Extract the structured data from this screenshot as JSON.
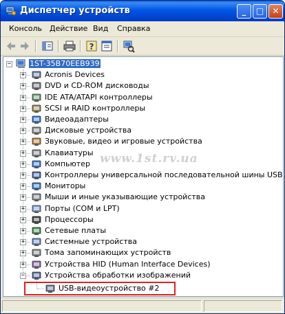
{
  "window": {
    "title": "Диспетчер устройств",
    "controls": {
      "minimize": "_",
      "maximize": "□",
      "close": "✕"
    }
  },
  "menu": {
    "items": [
      "Консоль",
      "Действие",
      "Вид",
      "Справка"
    ]
  },
  "toolbar": {
    "buttons": [
      "back-arrow-icon",
      "forward-arrow-icon",
      "console-tree-icon",
      "print-icon",
      "help-icon",
      "properties-icon",
      "scan-hardware-icon"
    ]
  },
  "tree": {
    "root": "1ST-35B70EEB939",
    "categories": [
      "Acronis Devices",
      "DVD и CD-ROM дисководы",
      "IDE ATA/ATAPI контроллеры",
      "SCSI и RAID контроллеры",
      "Видеоадаптеры",
      "Дисковые устройства",
      "Звуковые, видео и игровые устройства",
      "Клавиатуры",
      "Компьютер",
      "Контроллеры универсальной последовательной шины USB",
      "Мониторы",
      "Мыши и иные указывающие устройства",
      "Порты (COM и LPT)",
      "Процессоры",
      "Сетевые платы",
      "Системные устройства",
      "Тома запоминающих устройств",
      "Устройства HID (Human Interface Devices)",
      "Устройства обработки изображений"
    ],
    "expanded_child": "USB-видеоустройство #2",
    "expand_symbol": "+",
    "collapse_symbol": "−"
  },
  "watermark": "www.1st.rv.ua",
  "colors": {
    "selection": "#316ac5",
    "highlight_box": "#e02020",
    "title_bar": "#0058e6"
  }
}
